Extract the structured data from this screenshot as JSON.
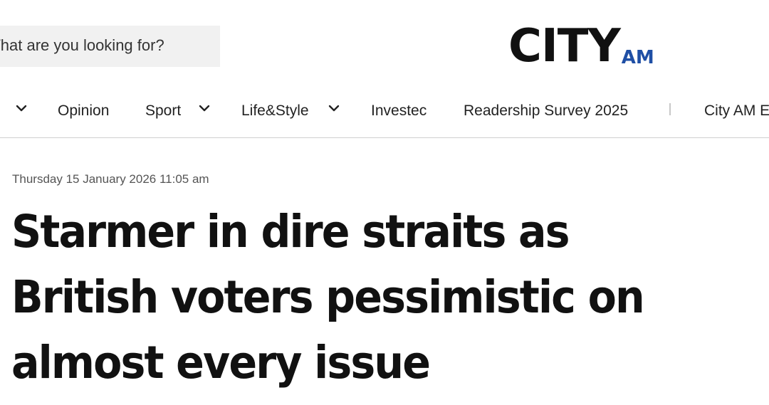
{
  "search": {
    "placeholder": "What are you looking for?"
  },
  "logo": {
    "city": "CITY",
    "am": "AM",
    "am_color": "#1f4fa5"
  },
  "nav": {
    "items": [
      {
        "label": "Opinion"
      },
      {
        "label": "Sport"
      },
      {
        "label": "Life&Style"
      },
      {
        "label": "Investec"
      },
      {
        "label": "Readership Survey 2025"
      },
      {
        "label": "City AM Events"
      }
    ],
    "dropdown_icon": "chevron-down-icon"
  },
  "article": {
    "dateline": "Thursday 15 January 2026 11:05 am",
    "headline": "Starmer in dire straits as British voters pessimistic on almost every issue"
  }
}
